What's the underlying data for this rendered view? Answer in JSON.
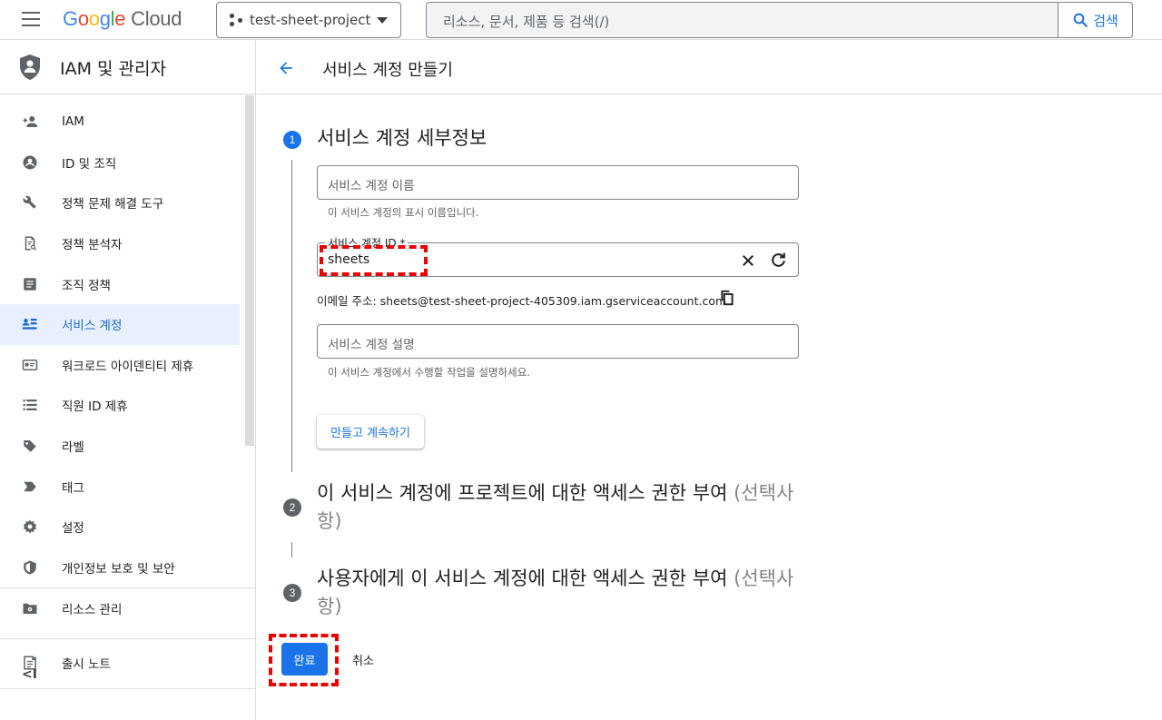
{
  "topbar": {
    "logo_letters": [
      "G",
      "o",
      "o",
      "g",
      "l",
      "e"
    ],
    "logo_product": "Cloud",
    "project_name": "test-sheet-project",
    "search_placeholder": "리소스, 문서, 제품 등 검색(/)",
    "search_button": "검색"
  },
  "sidebar": {
    "title": "IAM 및 관리자",
    "items": [
      {
        "label": "IAM",
        "icon": "person-add-icon"
      },
      {
        "label": "ID 및 조직",
        "icon": "account-circle-icon"
      },
      {
        "label": "정책 문제 해결 도구",
        "icon": "wrench-icon"
      },
      {
        "label": "정책 분석자",
        "icon": "document-search-icon"
      },
      {
        "label": "조직 정책",
        "icon": "list-document-icon"
      },
      {
        "label": "서비스 계정",
        "icon": "service-account-icon",
        "active": true
      },
      {
        "label": "워크로드 아이덴티티 제휴",
        "icon": "id-card-icon"
      },
      {
        "label": "직원 ID 제휴",
        "icon": "list-icon"
      },
      {
        "label": "라벨",
        "icon": "label-icon"
      },
      {
        "label": "태그",
        "icon": "tag-icon"
      },
      {
        "label": "설정",
        "icon": "gear-icon"
      },
      {
        "label": "개인정보 보호 및 보안",
        "icon": "shield-icon"
      }
    ],
    "resource_manage": "리소스 관리",
    "release_notes": "출시 노트",
    "collapse": "<I"
  },
  "main": {
    "page_title": "서비스 계정 만들기",
    "steps": [
      {
        "number": "1",
        "title": "서비스 계정 세부정보",
        "optional": ""
      },
      {
        "number": "2",
        "title": "이 서비스 계정에 프로젝트에 대한 액세스 권한 부여",
        "optional": "(선택사항)"
      },
      {
        "number": "3",
        "title": "사용자에게 이 서비스 계정에 대한 액세스 권한 부여",
        "optional": "(선택사항)"
      }
    ],
    "name_field": {
      "placeholder": "서비스 계정 이름",
      "hint": "이 서비스 계정의 표시 이름입니다."
    },
    "id_field": {
      "label": "서비스 계정 ID *",
      "value": "sheets"
    },
    "email_line": "이메일 주소: sheets@test-sheet-project-405309.iam.gserviceaccount.com",
    "desc_field": {
      "placeholder": "서비스 계정 설명",
      "hint": "이 서비스 계정에서 수행할 작업을 설명하세요."
    },
    "continue_button": "만들고 계속하기",
    "done_button": "완료",
    "cancel_button": "취소"
  },
  "colors": {
    "accent": "#1a73e8",
    "active_nav_bg": "#e8f0fe",
    "annotation": "#e00000"
  }
}
